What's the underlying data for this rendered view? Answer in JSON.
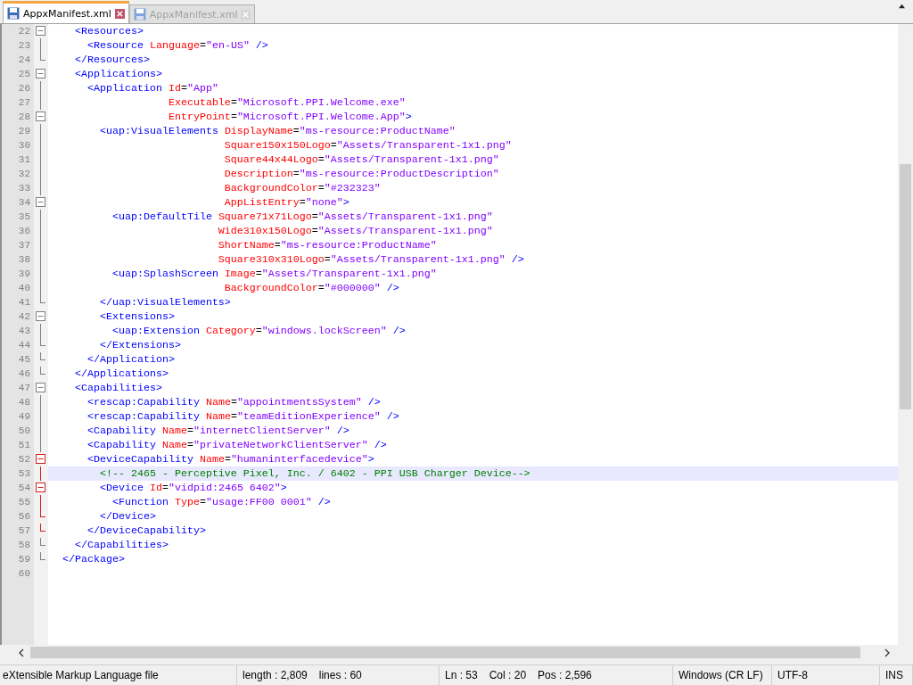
{
  "tabs": [
    {
      "label": "AppxManifest.xml",
      "selected": true
    },
    {
      "label": "AppxManifest.xml",
      "selected": false
    }
  ],
  "editor": {
    "lines": [
      {
        "n": "22",
        "kind": "start",
        "active": false,
        "current": false,
        "tokens": [
          {
            "kind": "tag",
            "s": "  <Resources>"
          }
        ]
      },
      {
        "n": "23",
        "kind": "body",
        "active": false,
        "current": false,
        "tokens": [
          {
            "kind": "tag",
            "s": "    <Resource "
          },
          {
            "kind": "attr",
            "s": "Language"
          },
          {
            "kind": "plain",
            "s": "="
          },
          {
            "kind": "value",
            "s": "\"en-US\""
          },
          {
            "kind": "tag",
            "s": " />"
          }
        ]
      },
      {
        "n": "24",
        "kind": "end",
        "active": false,
        "current": false,
        "tokens": [
          {
            "kind": "tag",
            "s": "  </Resources>"
          }
        ]
      },
      {
        "n": "25",
        "kind": "start",
        "active": false,
        "current": false,
        "tokens": [
          {
            "kind": "tag",
            "s": "  <Applications>"
          }
        ]
      },
      {
        "n": "26",
        "kind": "body",
        "active": false,
        "current": false,
        "tokens": [
          {
            "kind": "tag",
            "s": "    <Application "
          },
          {
            "kind": "attr",
            "s": "Id"
          },
          {
            "kind": "plain",
            "s": "="
          },
          {
            "kind": "value",
            "s": "\"App\""
          }
        ]
      },
      {
        "n": "27",
        "kind": "body",
        "active": false,
        "current": false,
        "tokens": [
          {
            "kind": "attr",
            "s": "                 Executable"
          },
          {
            "kind": "plain",
            "s": "="
          },
          {
            "kind": "value",
            "s": "\"Microsoft.PPI.Welcome.exe\""
          }
        ]
      },
      {
        "n": "28",
        "kind": "start",
        "active": false,
        "current": false,
        "tokens": [
          {
            "kind": "attr",
            "s": "                 EntryPoint"
          },
          {
            "kind": "plain",
            "s": "="
          },
          {
            "kind": "value",
            "s": "\"Microsoft.PPI.Welcome.App\""
          },
          {
            "kind": "tag",
            "s": ">"
          }
        ]
      },
      {
        "n": "29",
        "kind": "body",
        "active": false,
        "current": false,
        "tokens": [
          {
            "kind": "tag",
            "s": "      <uap:VisualElements "
          },
          {
            "kind": "attr",
            "s": "DisplayName"
          },
          {
            "kind": "plain",
            "s": "="
          },
          {
            "kind": "value",
            "s": "\"ms-resource:ProductName\""
          }
        ]
      },
      {
        "n": "30",
        "kind": "body",
        "active": false,
        "current": false,
        "tokens": [
          {
            "kind": "attr",
            "s": "                          Square150x150Logo"
          },
          {
            "kind": "plain",
            "s": "="
          },
          {
            "kind": "value",
            "s": "\"Assets/Transparent-1x1.png\""
          }
        ]
      },
      {
        "n": "31",
        "kind": "body",
        "active": false,
        "current": false,
        "tokens": [
          {
            "kind": "attr",
            "s": "                          Square44x44Logo"
          },
          {
            "kind": "plain",
            "s": "="
          },
          {
            "kind": "value",
            "s": "\"Assets/Transparent-1x1.png\""
          }
        ]
      },
      {
        "n": "32",
        "kind": "body",
        "active": false,
        "current": false,
        "tokens": [
          {
            "kind": "attr",
            "s": "                          Description"
          },
          {
            "kind": "plain",
            "s": "="
          },
          {
            "kind": "value",
            "s": "\"ms-resource:ProductDescription\""
          }
        ]
      },
      {
        "n": "33",
        "kind": "body",
        "active": false,
        "current": false,
        "tokens": [
          {
            "kind": "attr",
            "s": "                          BackgroundColor"
          },
          {
            "kind": "plain",
            "s": "="
          },
          {
            "kind": "value",
            "s": "\"#232323\""
          }
        ]
      },
      {
        "n": "34",
        "kind": "start",
        "active": false,
        "current": false,
        "tokens": [
          {
            "kind": "attr",
            "s": "                          AppListEntry"
          },
          {
            "kind": "plain",
            "s": "="
          },
          {
            "kind": "value",
            "s": "\"none\""
          },
          {
            "kind": "tag",
            "s": ">"
          }
        ]
      },
      {
        "n": "35",
        "kind": "body",
        "active": false,
        "current": false,
        "tokens": [
          {
            "kind": "tag",
            "s": "        <uap:DefaultTile "
          },
          {
            "kind": "attr",
            "s": "Square71x71Logo"
          },
          {
            "kind": "plain",
            "s": "="
          },
          {
            "kind": "value",
            "s": "\"Assets/Transparent-1x1.png\""
          }
        ]
      },
      {
        "n": "36",
        "kind": "body",
        "active": false,
        "current": false,
        "tokens": [
          {
            "kind": "attr",
            "s": "                         Wide310x150Logo"
          },
          {
            "kind": "plain",
            "s": "="
          },
          {
            "kind": "value",
            "s": "\"Assets/Transparent-1x1.png\""
          }
        ]
      },
      {
        "n": "37",
        "kind": "body",
        "active": false,
        "current": false,
        "tokens": [
          {
            "kind": "attr",
            "s": "                         ShortName"
          },
          {
            "kind": "plain",
            "s": "="
          },
          {
            "kind": "value",
            "s": "\"ms-resource:ProductName\""
          }
        ]
      },
      {
        "n": "38",
        "kind": "body",
        "active": false,
        "current": false,
        "tokens": [
          {
            "kind": "attr",
            "s": "                         Square310x310Logo"
          },
          {
            "kind": "plain",
            "s": "="
          },
          {
            "kind": "value",
            "s": "\"Assets/Transparent-1x1.png\""
          },
          {
            "kind": "tag",
            "s": " />"
          }
        ]
      },
      {
        "n": "39",
        "kind": "body",
        "active": false,
        "current": false,
        "tokens": [
          {
            "kind": "tag",
            "s": "        <uap:SplashScreen "
          },
          {
            "kind": "attr",
            "s": "Image"
          },
          {
            "kind": "plain",
            "s": "="
          },
          {
            "kind": "value",
            "s": "\"Assets/Transparent-1x1.png\""
          }
        ]
      },
      {
        "n": "40",
        "kind": "body",
        "active": false,
        "current": false,
        "tokens": [
          {
            "kind": "attr",
            "s": "                          BackgroundColor"
          },
          {
            "kind": "plain",
            "s": "="
          },
          {
            "kind": "value",
            "s": "\"#000000\""
          },
          {
            "kind": "tag",
            "s": " />"
          }
        ]
      },
      {
        "n": "41",
        "kind": "end",
        "active": false,
        "current": false,
        "tokens": [
          {
            "kind": "tag",
            "s": "      </uap:VisualElements>"
          }
        ]
      },
      {
        "n": "42",
        "kind": "start",
        "active": false,
        "current": false,
        "tokens": [
          {
            "kind": "tag",
            "s": "      <Extensions>"
          }
        ]
      },
      {
        "n": "43",
        "kind": "body",
        "active": false,
        "current": false,
        "tokens": [
          {
            "kind": "tag",
            "s": "        <uap:Extension "
          },
          {
            "kind": "attr",
            "s": "Category"
          },
          {
            "kind": "plain",
            "s": "="
          },
          {
            "kind": "value",
            "s": "\"windows.lockScreen\""
          },
          {
            "kind": "tag",
            "s": " />"
          }
        ]
      },
      {
        "n": "44",
        "kind": "end",
        "active": false,
        "current": false,
        "tokens": [
          {
            "kind": "tag",
            "s": "      </Extensions>"
          }
        ]
      },
      {
        "n": "45",
        "kind": "end",
        "active": false,
        "current": false,
        "tokens": [
          {
            "kind": "tag",
            "s": "    </Application>"
          }
        ]
      },
      {
        "n": "46",
        "kind": "end",
        "active": false,
        "current": false,
        "tokens": [
          {
            "kind": "tag",
            "s": "  </Applications>"
          }
        ]
      },
      {
        "n": "47",
        "kind": "start",
        "active": false,
        "current": false,
        "tokens": [
          {
            "kind": "tag",
            "s": "  <Capabilities>"
          }
        ]
      },
      {
        "n": "48",
        "kind": "body",
        "active": false,
        "current": false,
        "tokens": [
          {
            "kind": "tag",
            "s": "    <rescap:Capability "
          },
          {
            "kind": "attr",
            "s": "Name"
          },
          {
            "kind": "plain",
            "s": "="
          },
          {
            "kind": "value",
            "s": "\"appointmentsSystem\""
          },
          {
            "kind": "tag",
            "s": " />"
          }
        ]
      },
      {
        "n": "49",
        "kind": "body",
        "active": false,
        "current": false,
        "tokens": [
          {
            "kind": "tag",
            "s": "    <rescap:Capability "
          },
          {
            "kind": "attr",
            "s": "Name"
          },
          {
            "kind": "plain",
            "s": "="
          },
          {
            "kind": "value",
            "s": "\"teamEditionExperience\""
          },
          {
            "kind": "tag",
            "s": " />"
          }
        ]
      },
      {
        "n": "50",
        "kind": "body",
        "active": false,
        "current": false,
        "tokens": [
          {
            "kind": "tag",
            "s": "    <Capability "
          },
          {
            "kind": "attr",
            "s": "Name"
          },
          {
            "kind": "plain",
            "s": "="
          },
          {
            "kind": "value",
            "s": "\"internetClientServer\""
          },
          {
            "kind": "tag",
            "s": " />"
          }
        ]
      },
      {
        "n": "51",
        "kind": "body",
        "active": false,
        "current": false,
        "tokens": [
          {
            "kind": "tag",
            "s": "    <Capability "
          },
          {
            "kind": "attr",
            "s": "Name"
          },
          {
            "kind": "plain",
            "s": "="
          },
          {
            "kind": "value",
            "s": "\"privateNetworkClientServer\""
          },
          {
            "kind": "tag",
            "s": " />"
          }
        ]
      },
      {
        "n": "52",
        "kind": "start",
        "active": true,
        "current": false,
        "tokens": [
          {
            "kind": "tag",
            "s": "    <DeviceCapability "
          },
          {
            "kind": "attr",
            "s": "Name"
          },
          {
            "kind": "plain",
            "s": "="
          },
          {
            "kind": "value",
            "s": "\"humaninterfacedevice\""
          },
          {
            "kind": "tag",
            "s": ">"
          }
        ]
      },
      {
        "n": "53",
        "kind": "body",
        "active": true,
        "current": true,
        "tokens": [
          {
            "kind": "comment",
            "s": "      <!-- 2465 - Perceptive Pixel, Inc. / 6402 - PPI USB Charger Device-->"
          }
        ]
      },
      {
        "n": "54",
        "kind": "start",
        "active": true,
        "current": false,
        "tokens": [
          {
            "kind": "tag",
            "s": "      <Device "
          },
          {
            "kind": "attr",
            "s": "Id"
          },
          {
            "kind": "plain",
            "s": "="
          },
          {
            "kind": "value",
            "s": "\"vidpid:2465 6402\""
          },
          {
            "kind": "tag",
            "s": ">"
          }
        ]
      },
      {
        "n": "55",
        "kind": "body",
        "active": true,
        "current": false,
        "tokens": [
          {
            "kind": "tag",
            "s": "        <Function "
          },
          {
            "kind": "attr",
            "s": "Type"
          },
          {
            "kind": "plain",
            "s": "="
          },
          {
            "kind": "value",
            "s": "\"usage:FF00 0001\""
          },
          {
            "kind": "tag",
            "s": " />"
          }
        ]
      },
      {
        "n": "56",
        "kind": "end",
        "active": true,
        "current": false,
        "tokens": [
          {
            "kind": "tag",
            "s": "      </Device>"
          }
        ]
      },
      {
        "n": "57",
        "kind": "end",
        "active": true,
        "current": false,
        "tokens": [
          {
            "kind": "tag",
            "s": "    </DeviceCapability>"
          }
        ]
      },
      {
        "n": "58",
        "kind": "end",
        "active": false,
        "current": false,
        "tokens": [
          {
            "kind": "tag",
            "s": "  </Capabilities>"
          }
        ]
      },
      {
        "n": "59",
        "kind": "last",
        "active": false,
        "current": false,
        "tokens": [
          {
            "kind": "tag",
            "s": "</Package>"
          }
        ]
      },
      {
        "n": "60"
      }
    ]
  },
  "status_bar": {
    "file_type": "eXtensible Markup Language file",
    "length": "length : 2,809",
    "lines": "lines : 60",
    "ln": "Ln : 53",
    "col": "Col : 20",
    "pos": "Pos : 2,596",
    "eol": "Windows (CR LF)",
    "encoding": "UTF-8",
    "mode": "INS"
  }
}
